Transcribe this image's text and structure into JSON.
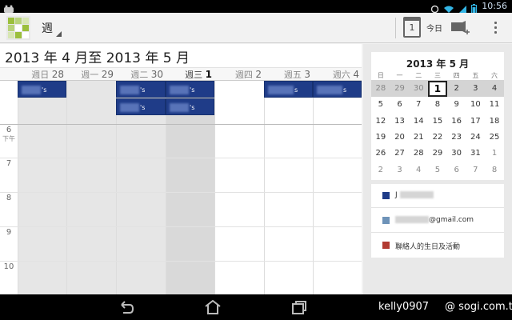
{
  "status_bar": {
    "time": "10:56"
  },
  "action_bar": {
    "view_selector": "週",
    "today_icon_day": "1",
    "today_label": "今日"
  },
  "week_view": {
    "range_title": "2013 年 4 月至 2013 年 5 月",
    "days": [
      {
        "dow": "週日",
        "num": "28"
      },
      {
        "dow": "週一",
        "num": "29"
      },
      {
        "dow": "週二",
        "num": "30"
      },
      {
        "dow": "週三",
        "num": "1"
      },
      {
        "dow": "週四",
        "num": "2"
      },
      {
        "dow": "週五",
        "num": "3"
      },
      {
        "dow": "週六",
        "num": "4"
      }
    ],
    "hours": [
      "6",
      "7",
      "8",
      "9",
      "10"
    ],
    "pm_label": "下午",
    "events": [
      {
        "text": "'s"
      },
      {
        "text": "'s"
      },
      {
        "text": "'s"
      },
      {
        "text": "s"
      },
      {
        "text": "s"
      },
      {
        "text": "'s"
      },
      {
        "text": "'s"
      }
    ]
  },
  "mini_calendar": {
    "title": "2013 年 5 月",
    "dow": [
      "日",
      "一",
      "二",
      "三",
      "四",
      "五",
      "六"
    ],
    "weeks": [
      [
        "28",
        "29",
        "30",
        "1",
        "2",
        "3",
        "4"
      ],
      [
        "5",
        "6",
        "7",
        "8",
        "9",
        "10",
        "11"
      ],
      [
        "12",
        "13",
        "14",
        "15",
        "16",
        "17",
        "18"
      ],
      [
        "19",
        "20",
        "21",
        "22",
        "23",
        "24",
        "25"
      ],
      [
        "26",
        "27",
        "28",
        "29",
        "30",
        "31",
        "1"
      ],
      [
        "2",
        "3",
        "4",
        "5",
        "6",
        "7",
        "8"
      ]
    ],
    "today": "1"
  },
  "calendars": [
    {
      "name": "J",
      "color": "#1f3c88"
    },
    {
      "name": "@gmail.com",
      "color": "#6e93b8"
    },
    {
      "name": "聯絡人的生日及活動",
      "color": "#b23b32"
    }
  ],
  "watermark": {
    "user": "kelly0907",
    "site": "@ sogi.com.tw"
  },
  "colors": {
    "event": "#1f3c88",
    "today_column": "#d9d9d9",
    "past_column": "#e6e6e6"
  }
}
